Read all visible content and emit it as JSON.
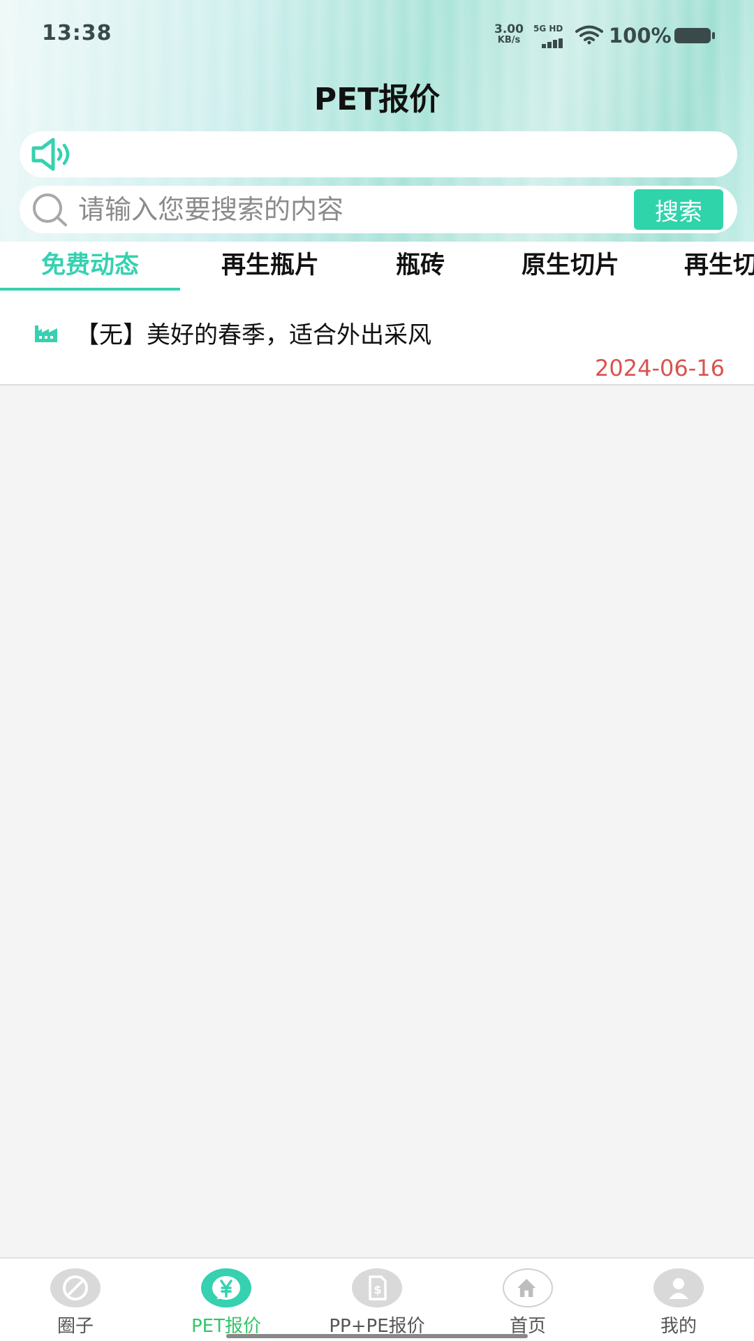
{
  "status_bar": {
    "time": "13:38",
    "net_speed_value": "3.00",
    "net_speed_unit": "KB/s",
    "signal_label": "5G HD",
    "battery_percent": "100%"
  },
  "header": {
    "title": "PET报价"
  },
  "search": {
    "placeholder": "请输入您要搜索的内容",
    "button_label": "搜索"
  },
  "tabs": [
    {
      "label": "免费动态",
      "active": true
    },
    {
      "label": "再生瓶片",
      "active": false
    },
    {
      "label": "瓶砖",
      "active": false
    },
    {
      "label": "原生切片",
      "active": false
    },
    {
      "label": "再生切",
      "active": false
    }
  ],
  "news": [
    {
      "title": "【无】美好的春季，适合外出采风",
      "date": "2024-06-16"
    }
  ],
  "bottom_nav": [
    {
      "label": "圈子",
      "icon": "circle-icon",
      "active": false
    },
    {
      "label": "PET报价",
      "icon": "yen-icon",
      "active": true
    },
    {
      "label": "PP+PE报价",
      "icon": "price-doc-icon",
      "active": false
    },
    {
      "label": "首页",
      "icon": "home-icon",
      "active": false
    },
    {
      "label": "我的",
      "icon": "user-icon",
      "active": false
    }
  ],
  "colors": {
    "accent": "#35d1b0",
    "search_button": "#2fd4ab",
    "date": "#d9534f",
    "nav_active_label": "#35c46a"
  }
}
